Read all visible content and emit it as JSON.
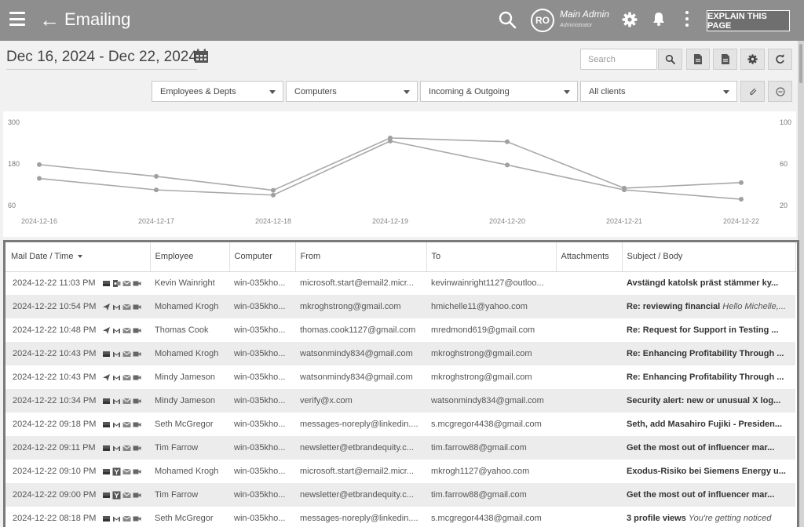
{
  "header": {
    "title": "Emailing",
    "user_initials": "RO",
    "user_name": "Main Admin",
    "user_role": "Administrator",
    "explain_label": "EXPLAIN THIS PAGE"
  },
  "date_range": "Dec 16, 2024 - Dec 22, 2024",
  "search": {
    "placeholder": "Search"
  },
  "filters": {
    "employees": "Employees & Depts",
    "computers": "Computers",
    "direction": "Incoming & Outgoing",
    "clients": "All clients"
  },
  "chart_data": {
    "type": "line",
    "x": [
      "2024-12-16",
      "2024-12-17",
      "2024-12-18",
      "2024-12-19",
      "2024-12-20",
      "2024-12-21",
      "2024-12-22"
    ],
    "left_axis": {
      "ticks": [
        300,
        180,
        60
      ],
      "ylim": [
        60,
        300
      ]
    },
    "right_axis": {
      "ticks": [
        100,
        60,
        20
      ],
      "ylim": [
        20,
        100
      ]
    },
    "series": [
      {
        "axis": "left",
        "values": [
          178,
          144,
          104,
          255,
          244,
          110,
          126
        ]
      },
      {
        "axis": "right",
        "values": [
          46,
          35,
          30,
          82,
          59,
          35,
          26
        ]
      }
    ],
    "grid": false,
    "legend": "none"
  },
  "table": {
    "columns": [
      "Mail Date / Time",
      "Employee",
      "Computer",
      "From",
      "To",
      "Attachments",
      "Subject / Body"
    ],
    "rows": [
      {
        "date": "2024-12-22 11:03 PM",
        "icons": [
          "inbox",
          "outlook",
          "mail",
          "video"
        ],
        "employee": "Kevin Wainright",
        "computer": "win-035kho...",
        "from": "microsoft.start@email2.micr...",
        "to": "kevinwainright1127@outloo...",
        "attachments": "",
        "subject": "Avstängd katolsk präst stämmer ky...",
        "body": ""
      },
      {
        "date": "2024-12-22 10:54 PM",
        "icons": [
          "send",
          "gmail",
          "mail",
          "video"
        ],
        "employee": "Mohamed Krogh",
        "computer": "win-035kho...",
        "from": "mkroghstrong@gmail.com",
        "to": "hmichelle11@yahoo.com",
        "attachments": "",
        "subject": "Re: reviewing financial",
        "body": "Hello Michelle,..."
      },
      {
        "date": "2024-12-22 10:48 PM",
        "icons": [
          "send",
          "gmail",
          "mail",
          "video"
        ],
        "employee": "Thomas Cook",
        "computer": "win-035kho...",
        "from": "thomas.cook1127@gmail.com",
        "to": "mredmond619@gmail.com",
        "attachments": "",
        "subject": "Re: Request for Support in Testing ...",
        "body": ""
      },
      {
        "date": "2024-12-22 10:43 PM",
        "icons": [
          "inbox",
          "gmail",
          "mail",
          "video"
        ],
        "employee": "Mohamed Krogh",
        "computer": "win-035kho...",
        "from": "watsonmindy834@gmail.com",
        "to": "mkroghstrong@gmail.com",
        "attachments": "",
        "subject": "Re: Enhancing Profitability Through ...",
        "body": ""
      },
      {
        "date": "2024-12-22 10:43 PM",
        "icons": [
          "send",
          "gmail",
          "mail",
          "video"
        ],
        "employee": "Mindy Jameson",
        "computer": "win-035kho...",
        "from": "watsonmindy834@gmail.com",
        "to": "mkroghstrong@gmail.com",
        "attachments": "",
        "subject": "Re: Enhancing Profitability Through ...",
        "body": ""
      },
      {
        "date": "2024-12-22 10:34 PM",
        "icons": [
          "inbox",
          "gmail",
          "mail",
          "video"
        ],
        "employee": "Mindy Jameson",
        "computer": "win-035kho...",
        "from": "verify@x.com",
        "to": "watsonmindy834@gmail.com",
        "attachments": "",
        "subject": "Security alert: new or unusual X log...",
        "body": ""
      },
      {
        "date": "2024-12-22 09:18 PM",
        "icons": [
          "inbox",
          "gmail",
          "mail",
          "video"
        ],
        "employee": "Seth McGregor",
        "computer": "win-035kho...",
        "from": "messages-noreply@linkedin....",
        "to": "s.mcgregor4438@gmail.com",
        "attachments": "",
        "subject": "Seth, add Masahiro Fujiki - Presiden...",
        "body": ""
      },
      {
        "date": "2024-12-22 09:11 PM",
        "icons": [
          "inbox",
          "gmail",
          "mail",
          "video"
        ],
        "employee": "Tim Farrow",
        "computer": "win-035kho...",
        "from": "newsletter@etbrandequity.c...",
        "to": "tim.farrow88@gmail.com",
        "attachments": "",
        "subject": "Get the most out of influencer mar...",
        "body": ""
      },
      {
        "date": "2024-12-22 09:10 PM",
        "icons": [
          "inbox",
          "yahoo",
          "mail",
          "video"
        ],
        "employee": "Mohamed Krogh",
        "computer": "win-035kho...",
        "from": "microsoft.start@email2.micr...",
        "to": "mkrogh1127@yahoo.com",
        "attachments": "",
        "subject": "Exodus-Risiko bei Siemens Energy u...",
        "body": ""
      },
      {
        "date": "2024-12-22 09:00 PM",
        "icons": [
          "inbox",
          "yahoo",
          "mail",
          "video"
        ],
        "employee": "Tim Farrow",
        "computer": "win-035kho...",
        "from": "newsletter@etbrandequity.c...",
        "to": "tim.farrow88@gmail.com",
        "attachments": "",
        "subject": "Get the most out of influencer mar...",
        "body": ""
      },
      {
        "date": "2024-12-22 08:18 PM",
        "icons": [
          "inbox",
          "gmail",
          "mail",
          "video"
        ],
        "employee": "Seth McGregor",
        "computer": "win-035kho...",
        "from": "messages-noreply@linkedin....",
        "to": "s.mcgregor4438@gmail.com",
        "attachments": "",
        "subject": "3 profile views",
        "body": "You're getting noticed"
      }
    ]
  },
  "colors": {
    "header_bg": "#8e8e8e",
    "line": "#a9a9a9",
    "point": "#a0a0a0"
  }
}
